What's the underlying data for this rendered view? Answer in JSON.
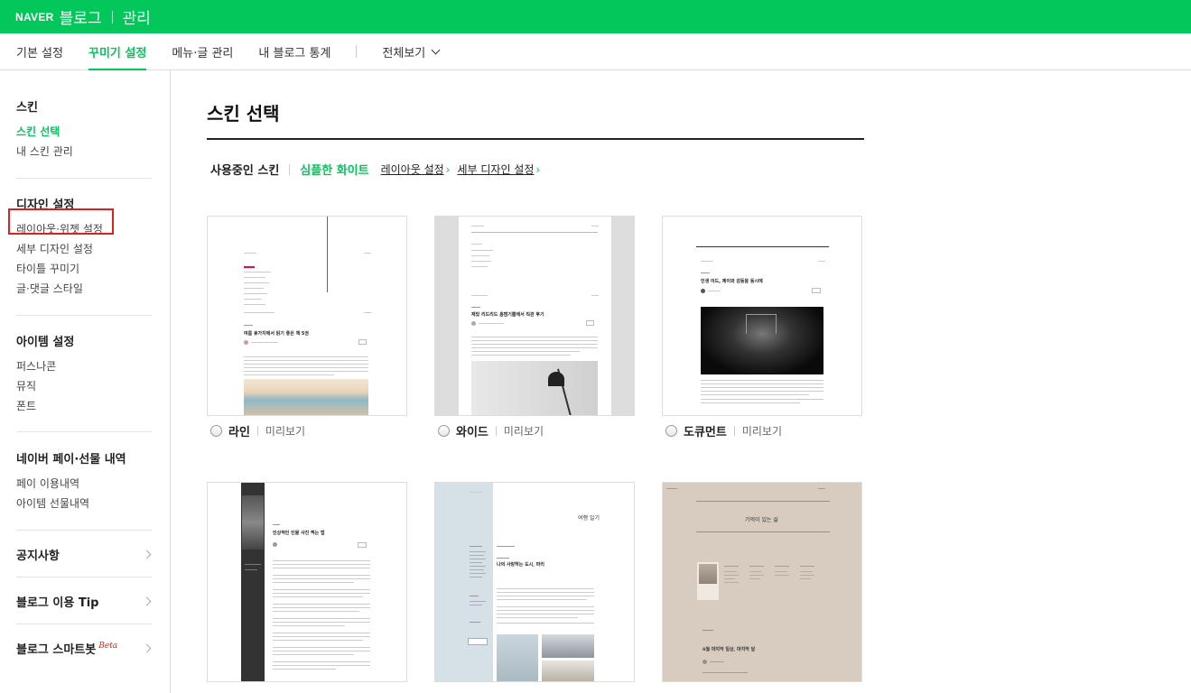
{
  "header": {
    "naver": "NAVER",
    "blog": "블로그",
    "manage": "관리"
  },
  "tabs": [
    {
      "label": "기본 설정"
    },
    {
      "label": "꾸미기 설정"
    },
    {
      "label": "메뉴·글 관리"
    },
    {
      "label": "내 블로그 통계"
    },
    {
      "label": "전체보기"
    }
  ],
  "sidebar": {
    "skin": {
      "title": "스킨",
      "items": [
        "스킨 선택",
        "내 스킨 관리"
      ]
    },
    "design": {
      "title": "디자인 설정",
      "items": [
        "레이아웃·위젯 설정",
        "세부 디자인 설정",
        "타이틀 꾸미기",
        "글·댓글 스타일"
      ]
    },
    "item": {
      "title": "아이템 설정",
      "items": [
        "퍼스나콘",
        "뮤직",
        "폰트"
      ]
    },
    "pay": {
      "title": "네이버 페이·선물 내역",
      "items": [
        "페이 이용내역",
        "아이템 선물내역"
      ]
    },
    "notice": "공지사항",
    "tip": "블로그 이용 Tip",
    "smartbot": "블로그 스마트봇",
    "beta": "Beta"
  },
  "main": {
    "title": "스킨 선택",
    "current_label": "사용중인 스킨",
    "current_skin": "심플한 화이트",
    "layout_link": "레이아웃 설정",
    "detail_link": "세부 디자인 설정",
    "preview_label": "미리보기",
    "skins": [
      {
        "name": "라인"
      },
      {
        "name": "와이드"
      },
      {
        "name": "도큐먼트"
      }
    ],
    "thumbs": {
      "line_title": "여름 휴가지에서 읽기 좋은 책 5권",
      "wide_title": "재밌 리드리드 홈캠기쁨에서 직관 후기",
      "doc_title": "인생 이드, 제이와 감동을 동시에",
      "r2a_title": "인상적인 인물 사진 찍는 법",
      "r2b_head": "여행 일기",
      "r2b_title": "나의 사랑하는 도시, 파리",
      "r2c_head": "기억이 있는 삶",
      "r2c_title": "6월 마지막 일상, 마지막 달"
    }
  },
  "colors": {
    "brand": "#03c75a",
    "highlight": "#e0201a"
  }
}
